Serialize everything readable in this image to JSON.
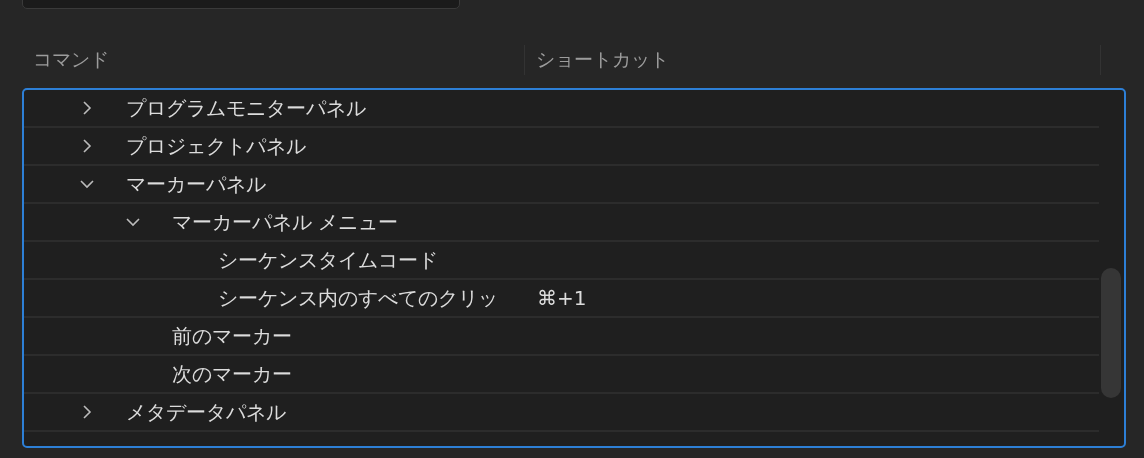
{
  "columns": [
    "コマンド",
    "ショートカット"
  ],
  "tree": [
    {
      "label": "プログラムモニターパネル",
      "expanded": false
    },
    {
      "label": "プロジェクトパネル",
      "expanded": false
    },
    {
      "label": "マーカーパネル",
      "expanded": true,
      "children": [
        {
          "label": "マーカーパネル メニュー",
          "expanded": true,
          "children": [
            {
              "label": "シーケンスタイムコード"
            },
            {
              "label": "シーケンス内のすべてのクリッ",
              "shortcut": "⌘+1"
            }
          ]
        },
        {
          "label": "前のマーカー"
        },
        {
          "label": "次のマーカー"
        }
      ]
    },
    {
      "label": "メタデータパネル",
      "expanded": false
    }
  ]
}
